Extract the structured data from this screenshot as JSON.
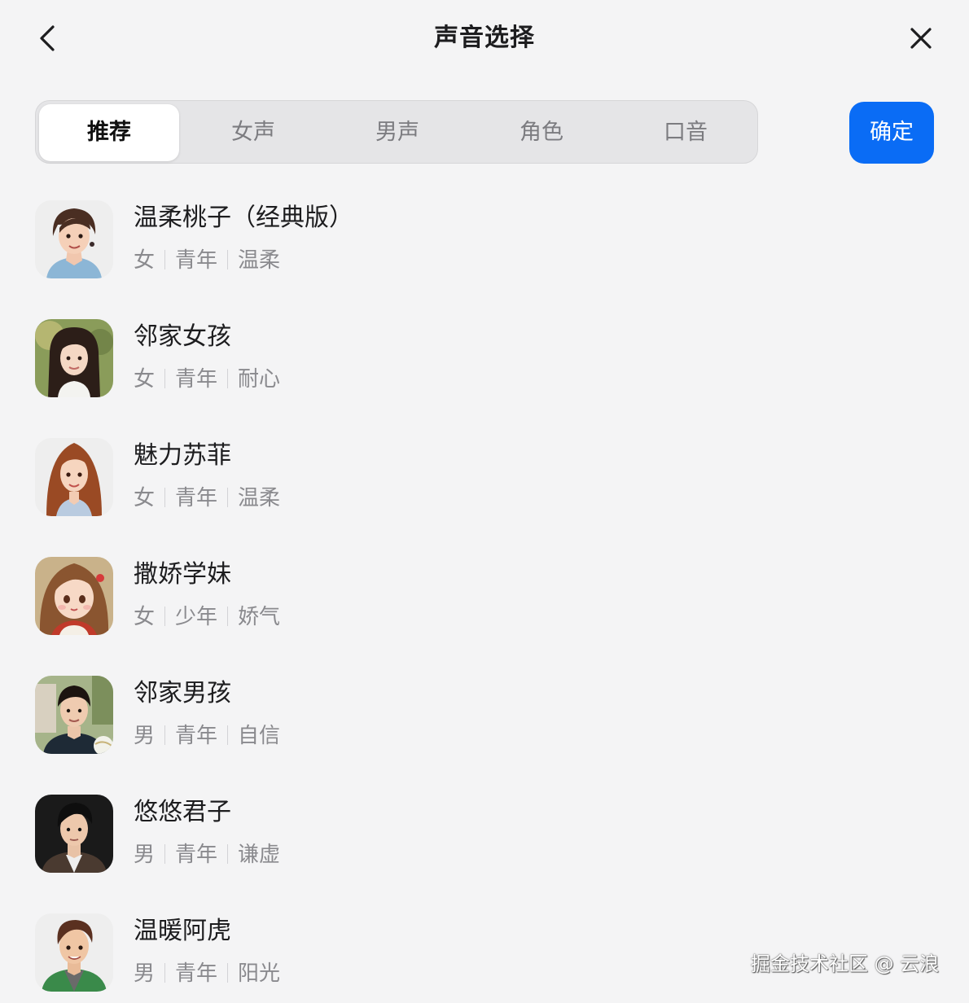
{
  "header": {
    "title": "声音选择",
    "back_icon": "chevron-left-icon",
    "close_icon": "close-icon"
  },
  "tabs": [
    {
      "label": "推荐",
      "active": true
    },
    {
      "label": "女声",
      "active": false
    },
    {
      "label": "男声",
      "active": false
    },
    {
      "label": "角色",
      "active": false
    },
    {
      "label": "口音",
      "active": false
    }
  ],
  "confirm_label": "确定",
  "colors": {
    "accent": "#0a6cf5",
    "background": "#f4f4f5",
    "tab_track": "#e5e5e7",
    "tag_text": "#8a8a8e"
  },
  "voices": [
    {
      "name": "温柔桃子（经典版）",
      "gender": "女",
      "age": "青年",
      "style": "温柔"
    },
    {
      "name": "邻家女孩",
      "gender": "女",
      "age": "青年",
      "style": "耐心"
    },
    {
      "name": "魅力苏菲",
      "gender": "女",
      "age": "青年",
      "style": "温柔"
    },
    {
      "name": "撒娇学妹",
      "gender": "女",
      "age": "少年",
      "style": "娇气"
    },
    {
      "name": "邻家男孩",
      "gender": "男",
      "age": "青年",
      "style": "自信"
    },
    {
      "name": "悠悠君子",
      "gender": "男",
      "age": "青年",
      "style": "谦虚"
    },
    {
      "name": "温暖阿虎",
      "gender": "男",
      "age": "青年",
      "style": "阳光"
    }
  ],
  "watermark": "掘金技术社区 @ 云浪"
}
